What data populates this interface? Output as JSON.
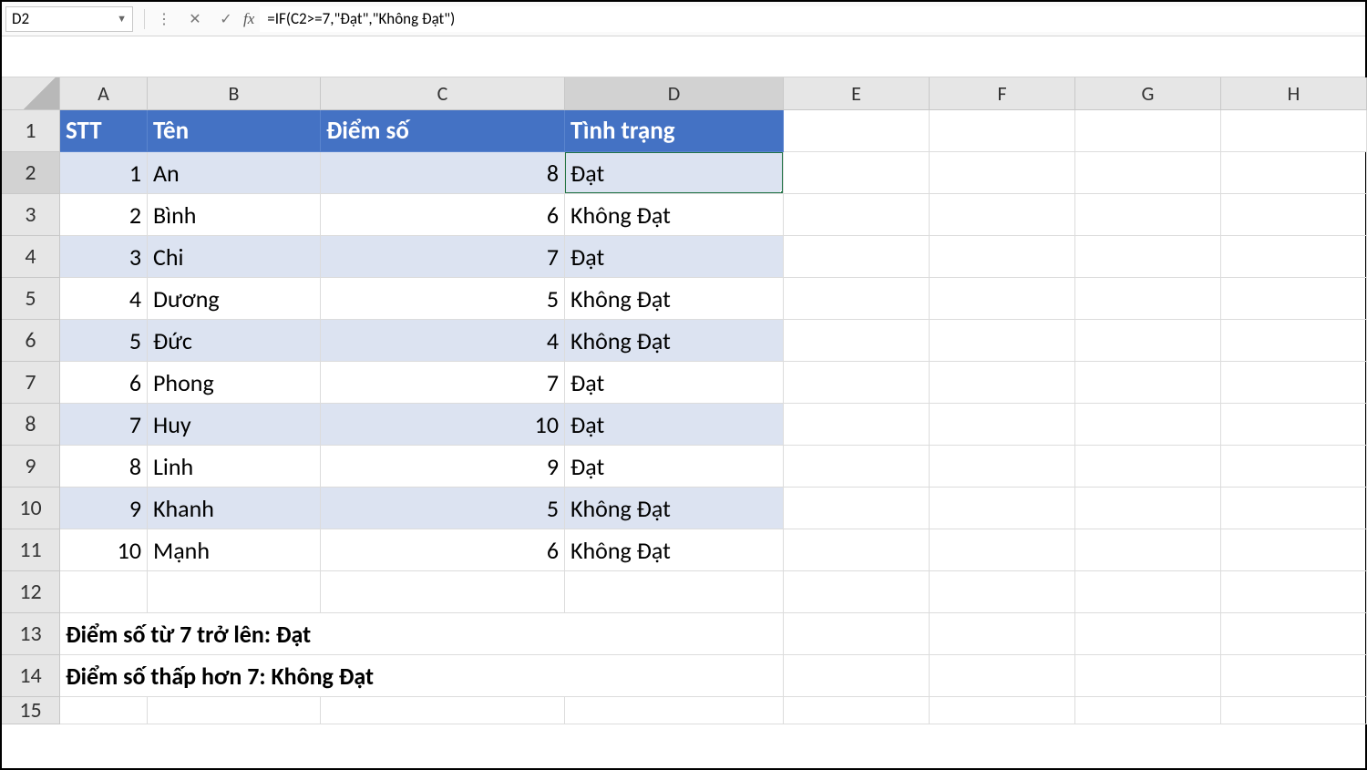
{
  "formula_bar": {
    "cell_ref": "D2",
    "fx_label": "fx",
    "formula": "=IF(C2>=7,\"Đạt\",\"Không Đạt\")"
  },
  "columns": [
    "A",
    "B",
    "C",
    "D",
    "E",
    "F",
    "G",
    "H"
  ],
  "row_numbers": [
    "1",
    "2",
    "3",
    "4",
    "5",
    "6",
    "7",
    "8",
    "9",
    "10",
    "11",
    "12",
    "13",
    "14",
    "15"
  ],
  "active_col": "D",
  "active_row": "2",
  "headers": {
    "stt": "STT",
    "ten": "Tên",
    "diem": "Điểm số",
    "tinh_trang": "Tình trạng"
  },
  "rows": [
    {
      "stt": "1",
      "ten": "An",
      "diem": "8",
      "tinh_trang": "Đạt"
    },
    {
      "stt": "2",
      "ten": "Bình",
      "diem": "6",
      "tinh_trang": "Không Đạt"
    },
    {
      "stt": "3",
      "ten": "Chi",
      "diem": "7",
      "tinh_trang": "Đạt"
    },
    {
      "stt": "4",
      "ten": "Dương",
      "diem": "5",
      "tinh_trang": "Không Đạt"
    },
    {
      "stt": "5",
      "ten": "Đức",
      "diem": "4",
      "tinh_trang": "Không Đạt"
    },
    {
      "stt": "6",
      "ten": "Phong",
      "diem": "7",
      "tinh_trang": "Đạt"
    },
    {
      "stt": "7",
      "ten": "Huy",
      "diem": "10",
      "tinh_trang": "Đạt"
    },
    {
      "stt": "8",
      "ten": "Linh",
      "diem": "9",
      "tinh_trang": "Đạt"
    },
    {
      "stt": "9",
      "ten": "Khanh",
      "diem": "5",
      "tinh_trang": "Không Đạt"
    },
    {
      "stt": "10",
      "ten": "Mạnh",
      "diem": "6",
      "tinh_trang": "Không Đạt"
    }
  ],
  "notes": {
    "line1": "Điểm số từ 7 trở lên: Đạt",
    "line2": "Điểm số thấp hơn 7: Không Đạt"
  }
}
